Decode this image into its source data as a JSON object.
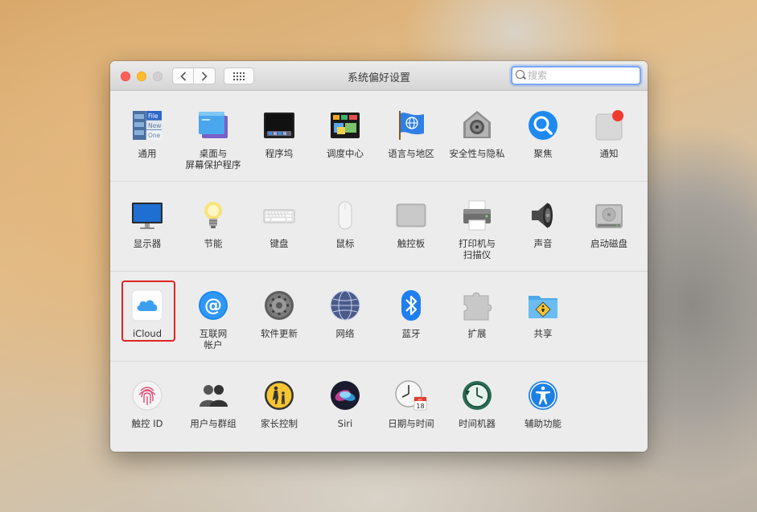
{
  "window": {
    "title": "系统偏好设置"
  },
  "search": {
    "placeholder": "搜索"
  },
  "rows": [
    [
      {
        "label": "通用",
        "icon": "general-icon"
      },
      {
        "label": "桌面与\n屏幕保护程序",
        "icon": "desktop-screensaver-icon"
      },
      {
        "label": "程序坞",
        "icon": "dock-icon"
      },
      {
        "label": "调度中心",
        "icon": "mission-control-icon"
      },
      {
        "label": "语言与地区",
        "icon": "language-region-icon"
      },
      {
        "label": "安全性与隐私",
        "icon": "security-privacy-icon"
      },
      {
        "label": "聚焦",
        "icon": "spotlight-icon"
      },
      {
        "label": "通知",
        "icon": "notifications-icon"
      }
    ],
    [
      {
        "label": "显示器",
        "icon": "displays-icon"
      },
      {
        "label": "节能",
        "icon": "energy-saver-icon"
      },
      {
        "label": "键盘",
        "icon": "keyboard-icon"
      },
      {
        "label": "鼠标",
        "icon": "mouse-icon"
      },
      {
        "label": "触控板",
        "icon": "trackpad-icon"
      },
      {
        "label": "打印机与\n扫描仪",
        "icon": "printers-scanners-icon"
      },
      {
        "label": "声音",
        "icon": "sound-icon"
      },
      {
        "label": "启动磁盘",
        "icon": "startup-disk-icon"
      }
    ],
    [
      {
        "label": "iCloud",
        "icon": "icloud-icon"
      },
      {
        "label": "互联网\n帐户",
        "icon": "internet-accounts-icon"
      },
      {
        "label": "软件更新",
        "icon": "software-update-icon"
      },
      {
        "label": "网络",
        "icon": "network-icon"
      },
      {
        "label": "蓝牙",
        "icon": "bluetooth-icon"
      },
      {
        "label": "扩展",
        "icon": "extensions-icon"
      },
      {
        "label": "共享",
        "icon": "sharing-icon"
      }
    ],
    [
      {
        "label": "触控 ID",
        "icon": "touch-id-icon"
      },
      {
        "label": "用户与群组",
        "icon": "users-groups-icon"
      },
      {
        "label": "家长控制",
        "icon": "parental-controls-icon"
      },
      {
        "label": "Siri",
        "icon": "siri-icon"
      },
      {
        "label": "日期与时间",
        "icon": "date-time-icon"
      },
      {
        "label": "时间机器",
        "icon": "time-machine-icon"
      },
      {
        "label": "辅助功能",
        "icon": "accessibility-icon"
      }
    ]
  ],
  "icon_text": {
    "general_file": "File",
    "general_new": "New",
    "general_one": "One",
    "calendar_month": "JUL",
    "calendar_day": "18"
  },
  "highlight_color": "#e02424"
}
